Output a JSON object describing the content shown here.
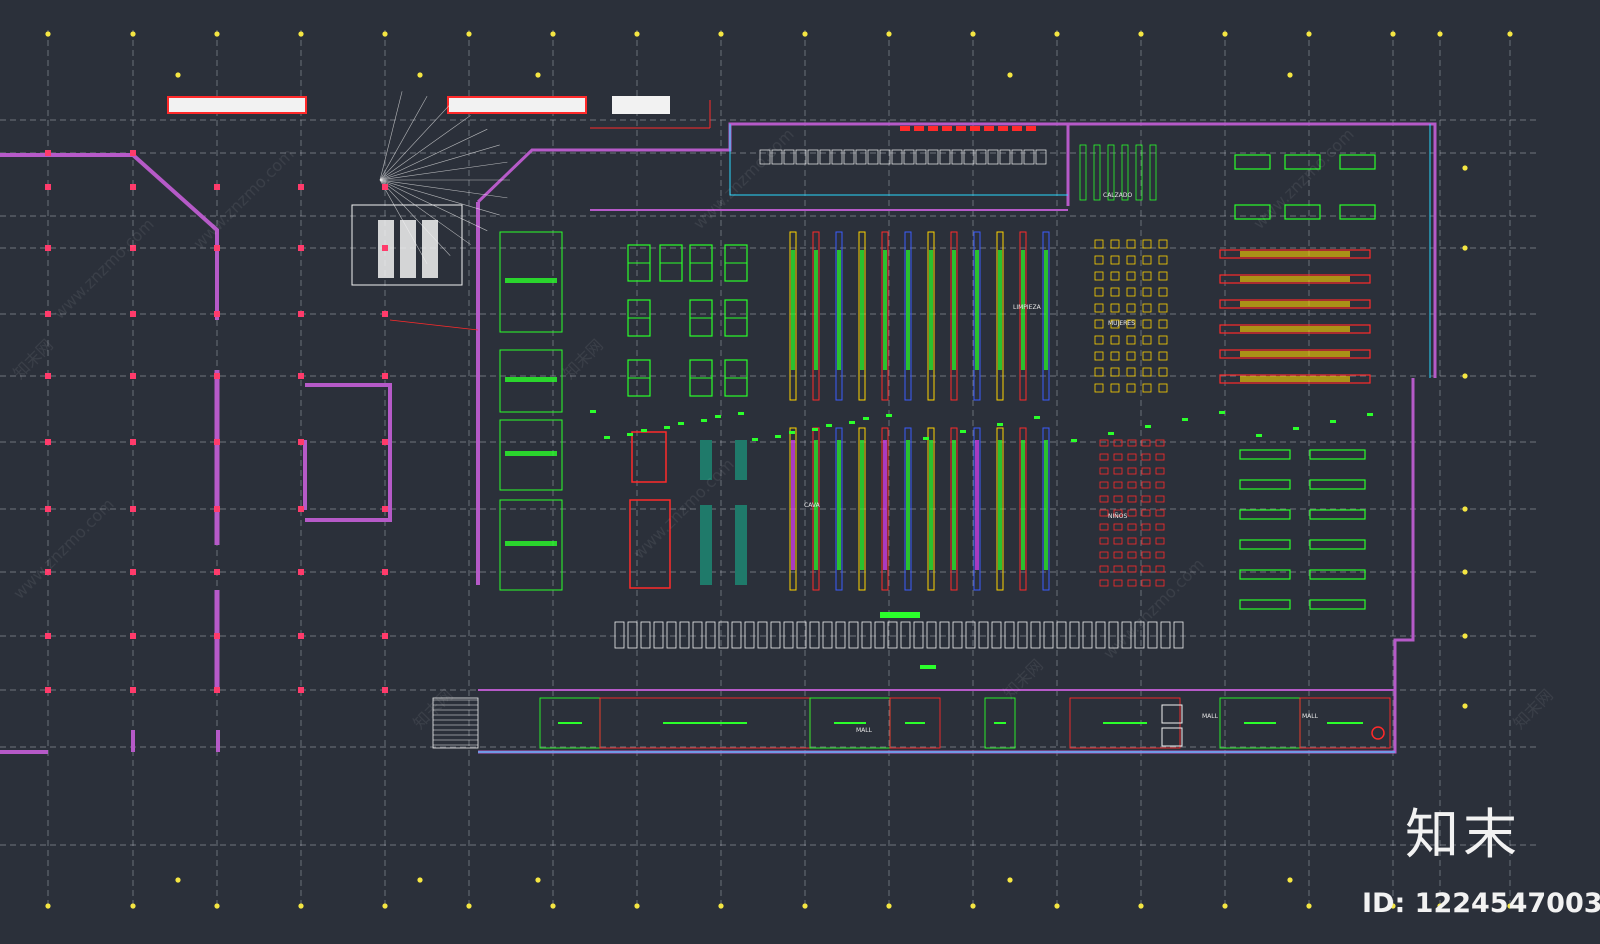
{
  "drawing": {
    "background": "#2b303a",
    "colors": {
      "grid": "#cfd3da",
      "column": "#ff3b6b",
      "axis_marker": "#f5e642",
      "wall": "#b65ac8",
      "fixture": "#2bff2b",
      "shelf_red": "#ff2a2a",
      "shelf_blue": "#3b5bff",
      "shelf_yellow": "#ffd400",
      "cyan": "#29d9ff",
      "white": "#f2f2f2",
      "orange": "#ff8a1e",
      "magenta": "#e040fb"
    },
    "labels": {
      "calzado": "CALZADO",
      "limpieza": "LIMPIEZA",
      "mujeres": "MUJERES",
      "cava": "CAVA",
      "ninos": "NIÑOS",
      "mall_1": "MALL",
      "mall_2": "MALL",
      "mall_3": "MALL"
    }
  },
  "watermark": {
    "site": "www.znzmo.com",
    "site_cn": "知末网"
  },
  "branding": {
    "logo_text": "知末",
    "id_text": "ID: 1224547003"
  }
}
